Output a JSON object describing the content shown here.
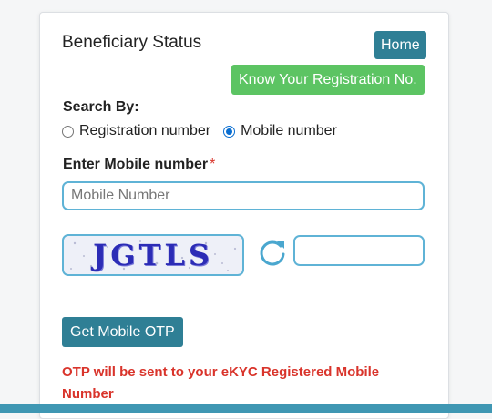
{
  "form": {
    "title": "Beneficiary Status",
    "home_label": "Home",
    "know_reg_label": "Know Your Registration No.",
    "search_by_label": "Search By:",
    "options": [
      {
        "label": "Registration number",
        "checked": false
      },
      {
        "label": "Mobile number",
        "checked": true
      }
    ],
    "enter_mobile_label": "Enter Mobile number",
    "required_mark": "*",
    "mobile_placeholder": "Mobile Number",
    "mobile_value": "",
    "captcha_text": "JGTLS",
    "captcha_value": "",
    "get_otp_label": "Get Mobile OTP",
    "otp_note": "OTP will be sent to your eKYC Registered Mobile Number"
  },
  "colors": {
    "primary": "#2f7f95",
    "success": "#5cc463",
    "danger": "#d9342b",
    "input_border": "#5fb3d6",
    "bottom_bar": "#3f97b3"
  },
  "icons": {
    "refresh": "refresh-icon"
  }
}
